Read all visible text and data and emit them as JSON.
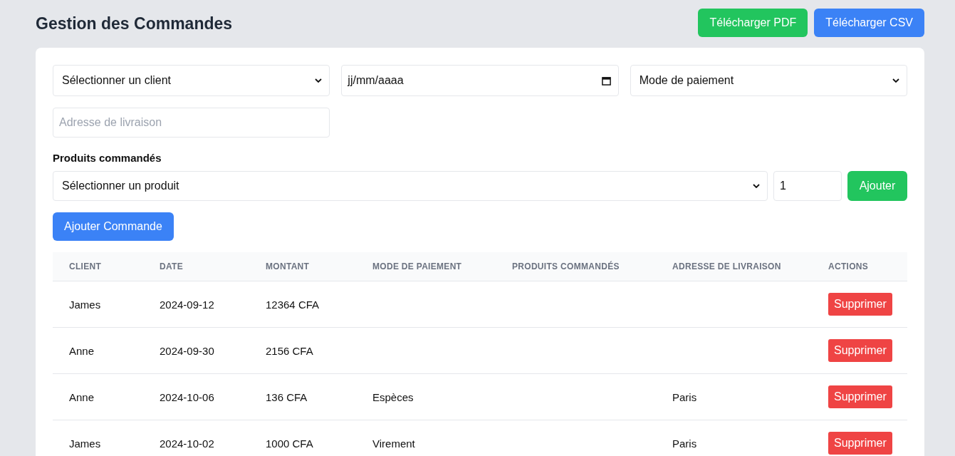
{
  "title": "Gestion des Commandes",
  "header_buttons": [
    {
      "label": "Télécharger PDF",
      "kind": "pdf"
    },
    {
      "label": "Télécharger CSV",
      "kind": "csv"
    }
  ],
  "form": {
    "client_select": "Sélectionner un client",
    "date_field": "jj/mm/aaaa",
    "payment_select": "Mode de paiement",
    "address": {
      "placeholder": "Adresse de livraison"
    },
    "products_label": "Produits commandés",
    "product_select": "Sélectionner un produit",
    "quantity": {
      "value": "1"
    },
    "add_product_button": "Ajouter",
    "submit_button": "Ajouter Commande"
  },
  "table": {
    "columns": [
      "CLIENT",
      "DATE",
      "MONTANT",
      "MODE DE PAIEMENT",
      "PRODUITS COMMANDÉS",
      "ADRESSE DE LIVRAISON",
      "ACTIONS"
    ],
    "rows": [
      {
        "client": "James",
        "date": "2024-09-12",
        "amount": "12364 CFA",
        "action": "Supprimer"
      },
      {
        "client": "Anne",
        "date": "2024-09-30",
        "amount": "2156 CFA",
        "action": "Supprimer"
      },
      {
        "client": "Anne",
        "date": "2024-10-06",
        "amount": "136 CFA",
        "payment": "Espèces",
        "address": "Paris",
        "action": "Supprimer"
      },
      {
        "client": "James",
        "date": "2024-10-02",
        "amount": "1000 CFA",
        "payment": "Virement",
        "address": "Paris",
        "action": "Supprimer"
      }
    ]
  }
}
